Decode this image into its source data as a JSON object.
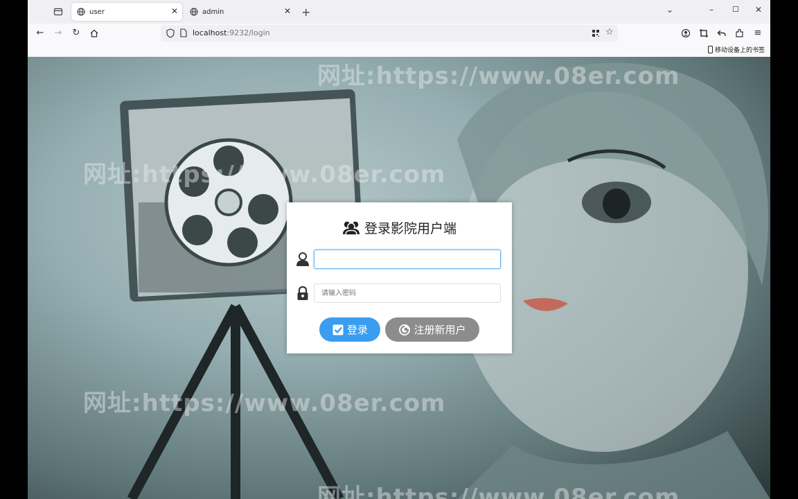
{
  "browser": {
    "tabs": [
      {
        "label": "user",
        "active": true
      },
      {
        "label": "admin",
        "active": false
      }
    ],
    "url": {
      "host": "localhost",
      "rest": ":9232/login"
    },
    "bookmarks": {
      "mobile_label": "移动设备上的书签"
    }
  },
  "watermark": {
    "text": "网址:https://www.08er.com"
  },
  "login": {
    "title": "登录影院用户端",
    "username_placeholder": "",
    "password_placeholder": "请输入密码",
    "login_button": "登录",
    "register_button": "注册新用户"
  },
  "colors": {
    "primary": "#3b9df0",
    "secondary": "#8c8c8c"
  }
}
